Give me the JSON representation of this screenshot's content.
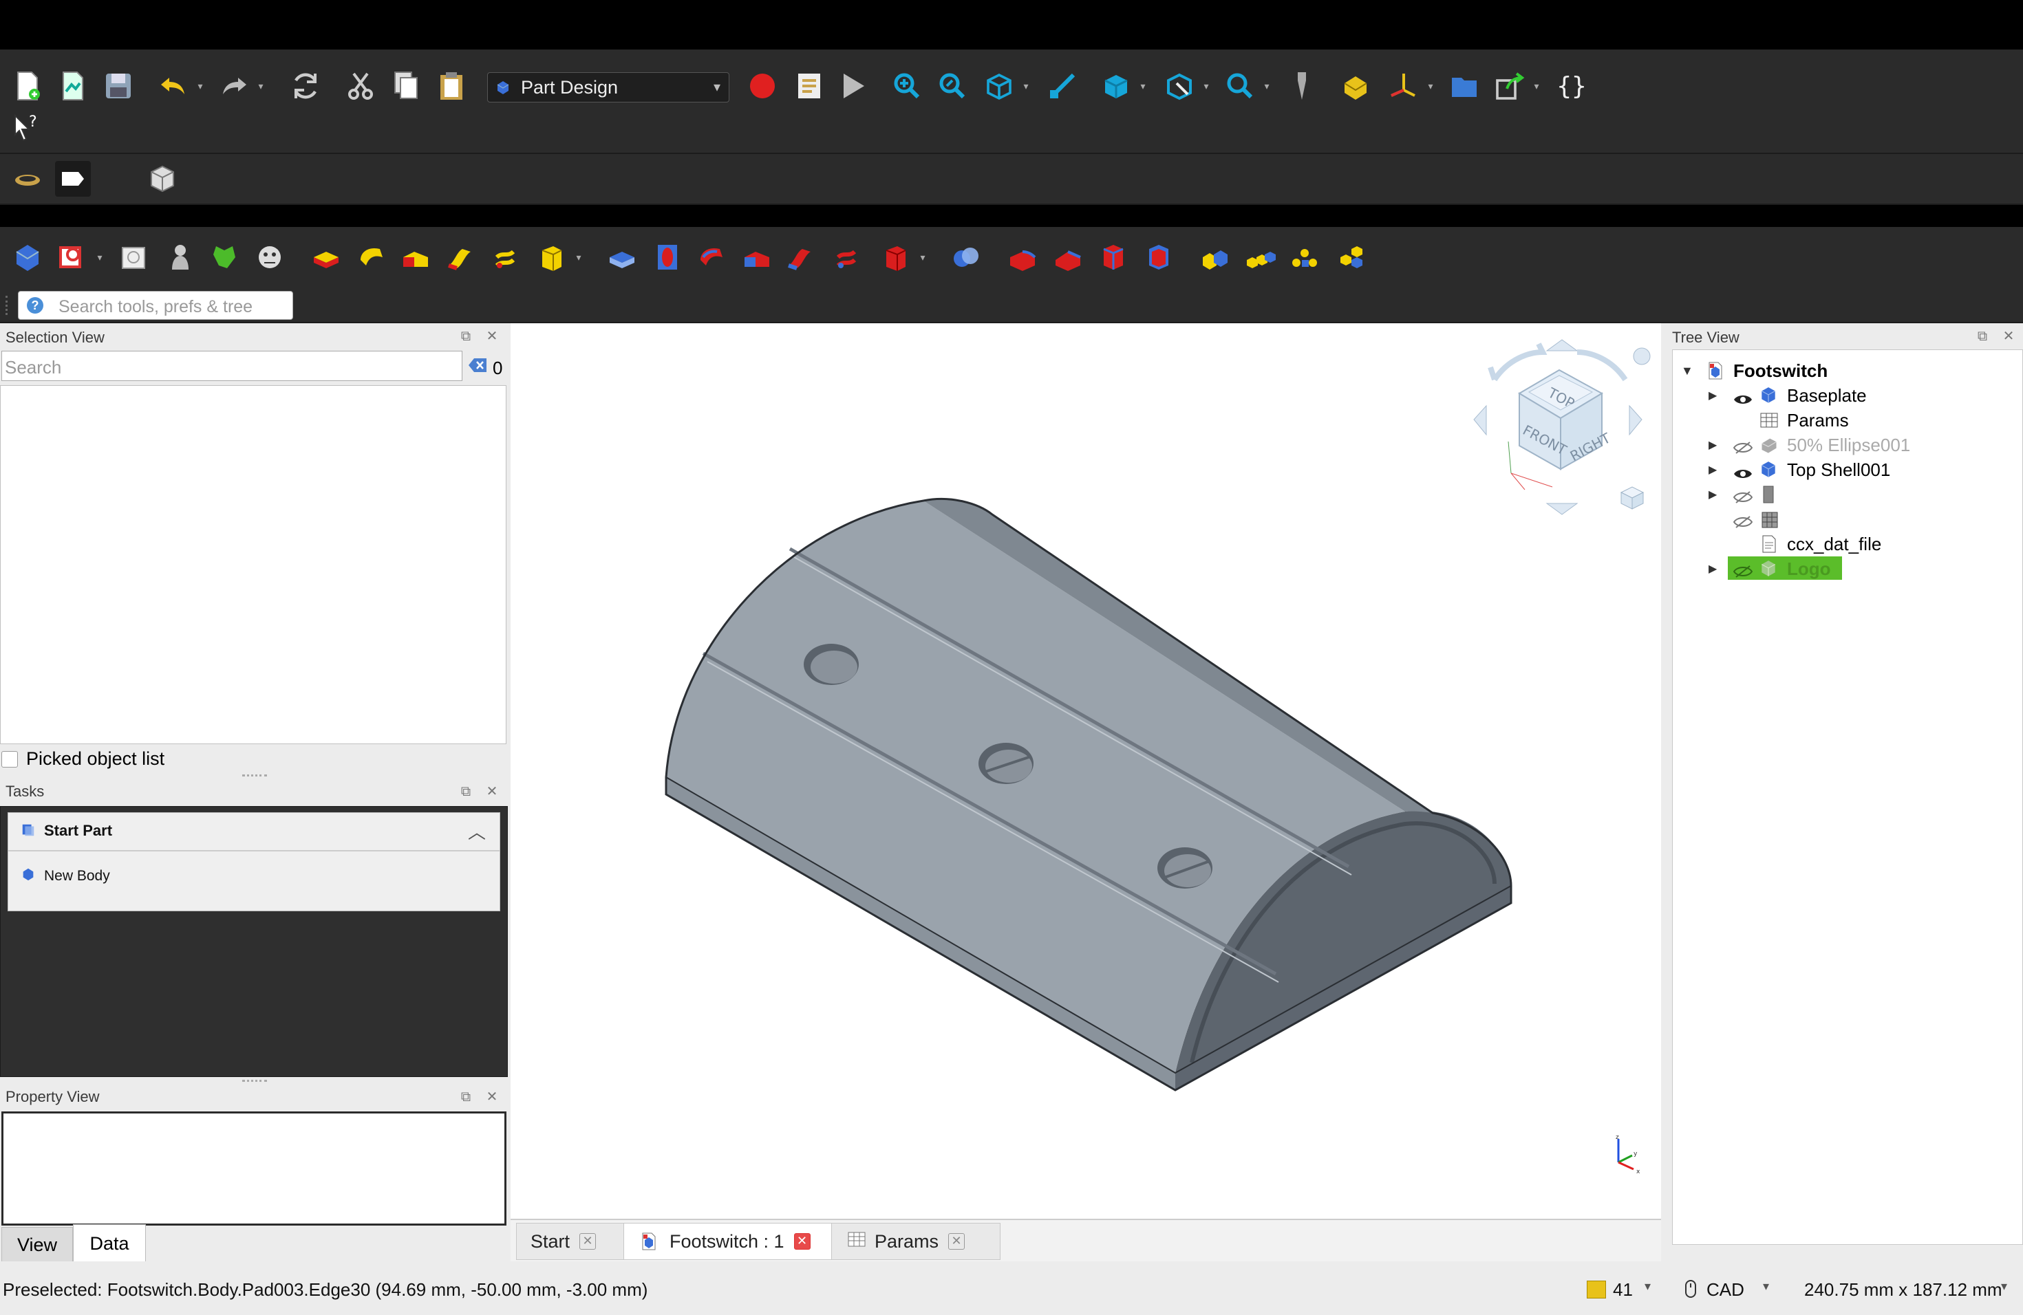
{
  "toolbar": {
    "workbench_label": "Part Design"
  },
  "search": {
    "tools_placeholder": "Search tools, prefs & tree"
  },
  "selection_view": {
    "title": "Selection View",
    "search_placeholder": "Search",
    "count": "0",
    "picked_list_label": "Picked object list"
  },
  "tasks": {
    "title": "Tasks",
    "section_title": "Start Part",
    "item": "New Body"
  },
  "property_view": {
    "title": "Property View",
    "tab_view": "View",
    "tab_data": "Data"
  },
  "tree_view": {
    "title": "Tree View",
    "root": "Footswitch",
    "items": [
      {
        "label": "Baseplate",
        "state": "visible"
      },
      {
        "label": "Params",
        "state": "none"
      },
      {
        "label": "50% Ellipse001",
        "state": "hidden"
      },
      {
        "label": "Top Shell001",
        "state": "visible"
      },
      {
        "label": "",
        "state": "hidden"
      },
      {
        "label": "",
        "state": "hidden"
      },
      {
        "label": "ccx_dat_file",
        "state": "none"
      },
      {
        "label": "Logo",
        "state": "selected"
      }
    ]
  },
  "navcube": {
    "top": "TOP",
    "front": "FRONT",
    "right": "RIGHT"
  },
  "doc_tabs": [
    {
      "label": "Start"
    },
    {
      "label": "Footswitch : 1"
    },
    {
      "label": "Params"
    }
  ],
  "status": {
    "preselected": "Preselected: Footswitch.Body.Pad003.Edge30 (94.69 mm, -50.00 mm, -3.00 mm)",
    "count": "41",
    "nav_style": "CAD",
    "dimensions": "240.75 mm x 187.12 mm"
  },
  "colors": {
    "accent_selected": "#5bbd2a",
    "record_red": "#e02020"
  }
}
